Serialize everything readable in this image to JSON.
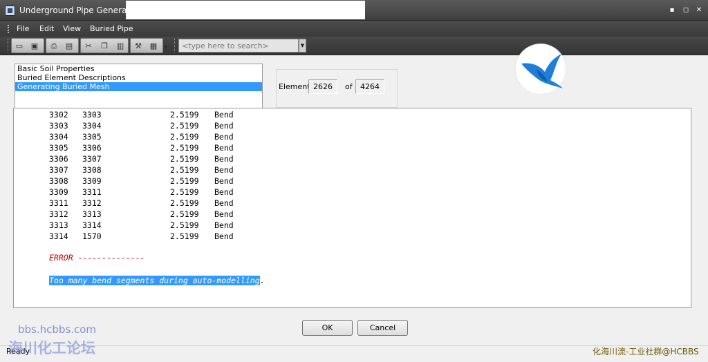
{
  "window": {
    "title": "Underground Pipe Generator",
    "minimize_glyph": "▪",
    "maximize_glyph": "◻",
    "close_glyph": "✕"
  },
  "menu": {
    "items": [
      "File",
      "Edit",
      "View",
      "Buried Pipe"
    ]
  },
  "toolbar": {
    "icons": [
      "open-folder-icon",
      "save-icon",
      "print-icon",
      "print-preview-icon",
      "cut-icon",
      "copy-icon",
      "paste-icon",
      "tool-icon",
      "window-icon"
    ],
    "search_placeholder": "<type here to search>"
  },
  "steps": {
    "items": [
      {
        "label": "Basic Soil Properties",
        "selected": false
      },
      {
        "label": "Buried Element Descriptions",
        "selected": false
      },
      {
        "label": "Generating Buried Mesh",
        "selected": true
      }
    ]
  },
  "element": {
    "label": "Element",
    "current": "2626",
    "of_label": "of",
    "total": "4264"
  },
  "log": {
    "rows": [
      {
        "from": "3302",
        "to": "3303",
        "value": "2.5199",
        "type": "Bend"
      },
      {
        "from": "3303",
        "to": "3304",
        "value": "2.5199",
        "type": "Bend"
      },
      {
        "from": "3304",
        "to": "3305",
        "value": "2.5199",
        "type": "Bend"
      },
      {
        "from": "3305",
        "to": "3306",
        "value": "2.5199",
        "type": "Bend"
      },
      {
        "from": "3306",
        "to": "3307",
        "value": "2.5199",
        "type": "Bend"
      },
      {
        "from": "3307",
        "to": "3308",
        "value": "2.5199",
        "type": "Bend"
      },
      {
        "from": "3308",
        "to": "3309",
        "value": "2.5199",
        "type": "Bend"
      },
      {
        "from": "3309",
        "to": "3311",
        "value": "2.5199",
        "type": "Bend"
      },
      {
        "from": "3311",
        "to": "3312",
        "value": "2.5199",
        "type": "Bend"
      },
      {
        "from": "3312",
        "to": "3313",
        "value": "2.5199",
        "type": "Bend"
      },
      {
        "from": "3313",
        "to": "3314",
        "value": "2.5199",
        "type": "Bend"
      },
      {
        "from": "3314",
        "to": "1570",
        "value": "2.5199",
        "type": "Bend"
      }
    ],
    "error_label": "ERROR --------------",
    "error_message": "Too many bend segments during auto-modelling",
    "error_message_suffix": "."
  },
  "buttons": {
    "ok": "OK",
    "cancel": "Cancel"
  },
  "status": {
    "text": "Ready"
  },
  "watermarks": {
    "site": "bbs.hcbbs.com",
    "forum": "海川化工论坛",
    "credit": "化海川流-工业社群@HCBBS"
  }
}
